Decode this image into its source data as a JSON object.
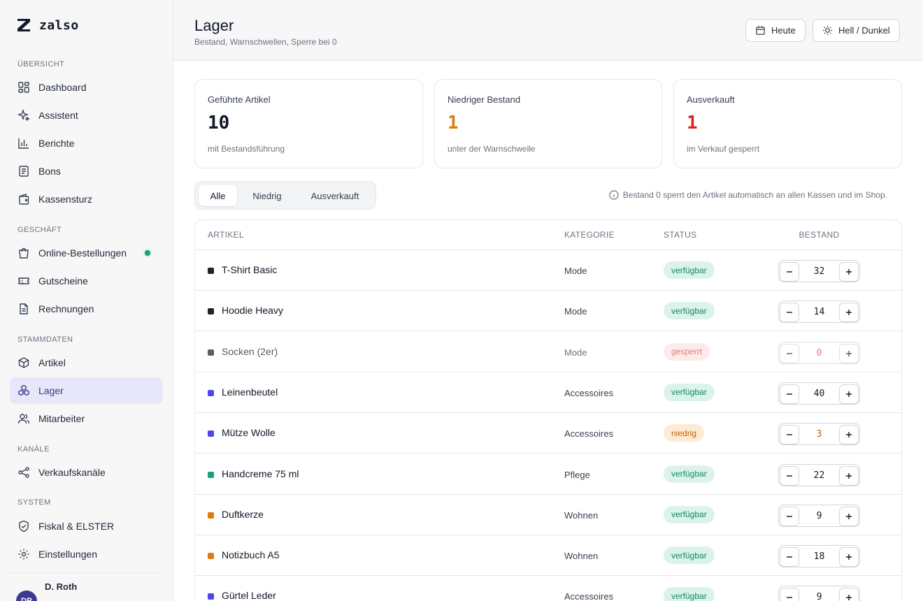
{
  "app": {
    "name": "zalso"
  },
  "sidebar": {
    "sections": [
      {
        "label": "ÜBERSICHT",
        "items": [
          {
            "label": "Dashboard",
            "icon": "dashboard-icon"
          },
          {
            "label": "Assistent",
            "icon": "sparkle-icon"
          },
          {
            "label": "Berichte",
            "icon": "bar-chart-icon"
          },
          {
            "label": "Bons",
            "icon": "receipt-icon"
          },
          {
            "label": "Kassensturz",
            "icon": "wallet-icon"
          }
        ]
      },
      {
        "label": "GESCHÄFT",
        "items": [
          {
            "label": "Online-Bestellungen",
            "icon": "shopping-bag-icon",
            "status_dot": true
          },
          {
            "label": "Gutscheine",
            "icon": "ticket-icon"
          },
          {
            "label": "Rechnungen",
            "icon": "document-icon"
          }
        ]
      },
      {
        "label": "STAMMDATEN",
        "items": [
          {
            "label": "Artikel",
            "icon": "box-icon"
          },
          {
            "label": "Lager",
            "icon": "stock-icon",
            "active": true
          },
          {
            "label": "Mitarbeiter",
            "icon": "users-icon"
          }
        ]
      },
      {
        "label": "KANÄLE",
        "items": [
          {
            "label": "Verkaufskanäle",
            "icon": "share-icon"
          }
        ]
      },
      {
        "label": "SYSTEM",
        "items": [
          {
            "label": "Fiskal & ELSTER",
            "icon": "shield-check-icon"
          },
          {
            "label": "Einstellungen",
            "icon": "gear-icon"
          }
        ]
      }
    ],
    "user": {
      "name": "D. Roth",
      "initials": "DR"
    }
  },
  "header": {
    "title": "Lager",
    "subtitle": "Bestand, Warnschwellen, Sperre bei 0",
    "today_label": "Heute",
    "theme_label": "Hell / Dunkel"
  },
  "stats": [
    {
      "label": "Geführte Artikel",
      "value": "10",
      "sub": "mit Bestandsführung",
      "color": "#111827"
    },
    {
      "label": "Niedriger Bestand",
      "value": "1",
      "sub": "unter der Warnschwelle",
      "color": "#e07b12"
    },
    {
      "label": "Ausverkauft",
      "value": "1",
      "sub": "im Verkauf gesperrt",
      "color": "#dc2626"
    }
  ],
  "filters": {
    "tabs": [
      "Alle",
      "Niedrig",
      "Ausverkauft"
    ],
    "active": 0
  },
  "hint": "Bestand 0 sperrt den Artikel automatisch an allen Kassen und im Shop.",
  "table": {
    "columns": {
      "item": "ARTIKEL",
      "category": "KATEGORIE",
      "status": "STATUS",
      "stock": "BESTAND"
    },
    "rows": [
      {
        "name": "T-Shirt Basic",
        "category": "Mode",
        "status": "verfügbar",
        "status_type": "ok",
        "stock": "32",
        "color": "#1f2328"
      },
      {
        "name": "Hoodie Heavy",
        "category": "Mode",
        "status": "verfügbar",
        "status_type": "ok",
        "stock": "14",
        "color": "#1f2328"
      },
      {
        "name": "Socken (2er)",
        "category": "Mode",
        "status": "gesperrt",
        "status_type": "locked",
        "stock": "0",
        "color": "#1f2328"
      },
      {
        "name": "Leinenbeutel",
        "category": "Accessoires",
        "status": "verfügbar",
        "status_type": "ok",
        "stock": "40",
        "color": "#4f46e5"
      },
      {
        "name": "Mütze Wolle",
        "category": "Accessoires",
        "status": "niedrig",
        "status_type": "low",
        "stock": "3",
        "color": "#4f46e5"
      },
      {
        "name": "Handcreme 75 ml",
        "category": "Pflege",
        "status": "verfügbar",
        "status_type": "ok",
        "stock": "22",
        "color": "#10a37f"
      },
      {
        "name": "Duftkerze",
        "category": "Wohnen",
        "status": "verfügbar",
        "status_type": "ok",
        "stock": "9",
        "color": "#e07b12"
      },
      {
        "name": "Notizbuch A5",
        "category": "Wohnen",
        "status": "verfügbar",
        "status_type": "ok",
        "stock": "18",
        "color": "#e07b12"
      },
      {
        "name": "Gürtel Leder",
        "category": "Accessoires",
        "status": "verfügbar",
        "status_type": "ok",
        "stock": "9",
        "color": "#4f46e5"
      }
    ]
  },
  "colors": {
    "accent": "#3b3a8f",
    "ok_bg": "#dcf3ea",
    "ok_text": "#0f8a5f",
    "low_bg": "#fdebd3",
    "low_text": "#c2620a",
    "locked_bg": "#fde4e2",
    "locked_text": "#dc4a3d"
  }
}
